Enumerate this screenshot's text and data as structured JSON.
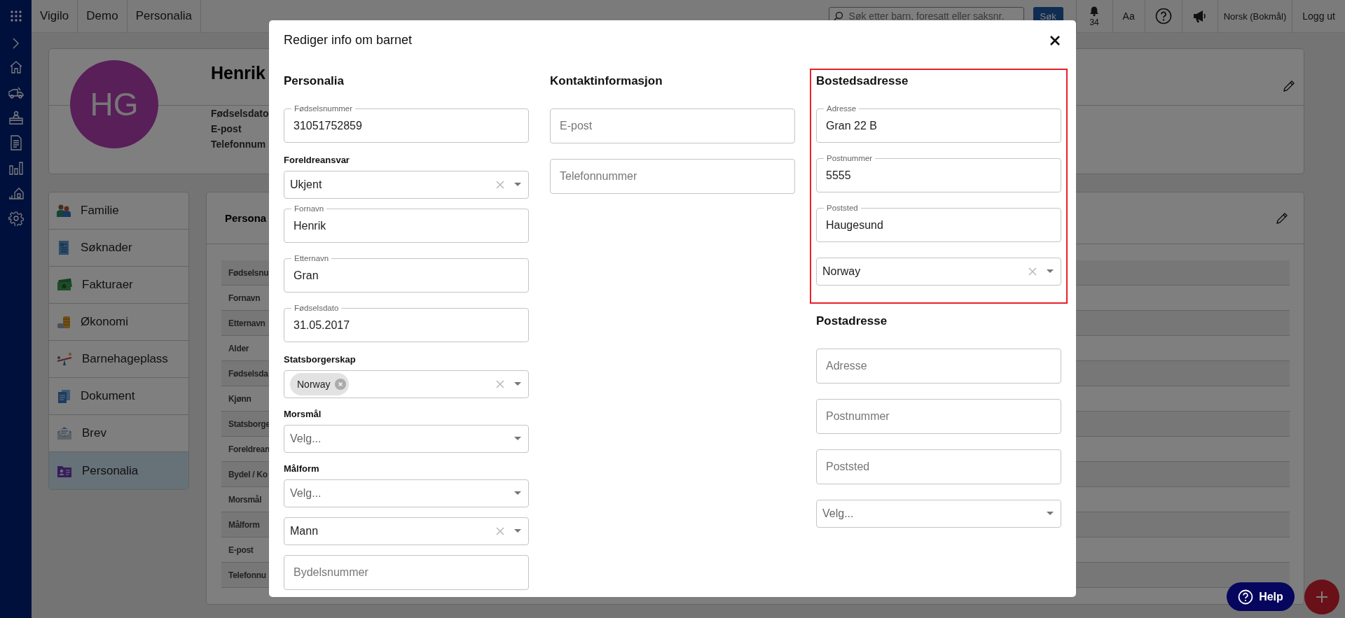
{
  "topbar": {
    "breadcrumb": [
      {
        "label": "Vigilo"
      },
      {
        "label": "Demo"
      },
      {
        "label": "Personalia"
      }
    ],
    "search": {
      "placeholder": "Søk etter barn, foresatt eller saksnr."
    },
    "search_button": "Søk",
    "notification_count": "34",
    "text_size_button": "Aa",
    "language": "Norsk (Bokmål)",
    "logout": "Logg ut"
  },
  "profile": {
    "initials": "HG",
    "name": "Henrik",
    "fields": [
      "Fødselsdato",
      "E-post",
      "Telefonnum"
    ]
  },
  "menu": [
    {
      "label": "Familie",
      "selected": false
    },
    {
      "label": "Søknader",
      "selected": false
    },
    {
      "label": "Fakturaer",
      "selected": false
    },
    {
      "label": "Økonomi",
      "selected": false
    },
    {
      "label": "Barnehageplass",
      "selected": false
    },
    {
      "label": "Dokument",
      "selected": false
    },
    {
      "label": "Brev",
      "selected": false
    },
    {
      "label": "Personalia",
      "selected": true
    }
  ],
  "details": {
    "title": "Persona",
    "rows": [
      "Fødselsnu",
      "Fornavn",
      "Etternavn",
      "Alder",
      "Fødselsda",
      "Kjønn",
      "Statsborge",
      "Foreldrean",
      "Bydel / Ko",
      "Morsmål",
      "Målform",
      "E-post",
      "Telefonnu"
    ]
  },
  "modal": {
    "title": "Rediger info om barnet",
    "columns": [
      [
        {
          "heading": "Personalia",
          "highlighted": false,
          "items": [
            {
              "kind": "text",
              "label": "Fødselsnummer",
              "value": "31051752859"
            },
            {
              "kind": "caption",
              "text": "Foreldreansvar"
            },
            {
              "kind": "select",
              "value": "Ukjent",
              "clearable": true
            },
            {
              "kind": "text",
              "label": "Fornavn",
              "value": "Henrik"
            },
            {
              "kind": "text",
              "label": "Etternavn",
              "value": "Gran"
            },
            {
              "kind": "text",
              "label": "Fødselsdato",
              "value": "31.05.2017"
            },
            {
              "kind": "caption",
              "text": "Statsborgerskap"
            },
            {
              "kind": "select",
              "chips": [
                "Norway"
              ],
              "clearable": true
            },
            {
              "kind": "caption",
              "text": "Morsmål"
            },
            {
              "kind": "select",
              "placeholder": "Velg...",
              "clearable": false
            },
            {
              "kind": "caption",
              "text": "Målform"
            },
            {
              "kind": "select",
              "placeholder": "Velg...",
              "clearable": false
            },
            {
              "kind": "select",
              "value": "Mann",
              "clearable": true
            },
            {
              "kind": "text",
              "placeholder": "Bydelsnummer"
            }
          ]
        }
      ],
      [
        {
          "heading": "Kontaktinformasjon",
          "highlighted": false,
          "items": [
            {
              "kind": "text",
              "placeholder": "E-post"
            },
            {
              "kind": "text",
              "placeholder": "Telefonnummer"
            }
          ]
        }
      ],
      [
        {
          "heading": "Bostedsadresse",
          "highlighted": true,
          "items": [
            {
              "kind": "text",
              "label": "Adresse",
              "value": "Gran 22 B"
            },
            {
              "kind": "text",
              "label": "Postnummer",
              "value": "5555"
            },
            {
              "kind": "text",
              "label": "Poststed",
              "value": "Haugesund"
            },
            {
              "kind": "select",
              "value": "Norway",
              "clearable": true
            }
          ]
        },
        {
          "heading": "Postadresse",
          "highlighted": false,
          "items": [
            {
              "kind": "text",
              "placeholder": "Adresse"
            },
            {
              "kind": "text",
              "placeholder": "Postnummer"
            },
            {
              "kind": "text",
              "placeholder": "Poststed"
            },
            {
              "kind": "select",
              "placeholder": "Velg...",
              "clearable": false
            }
          ]
        }
      ]
    ]
  },
  "help_button": "Help"
}
